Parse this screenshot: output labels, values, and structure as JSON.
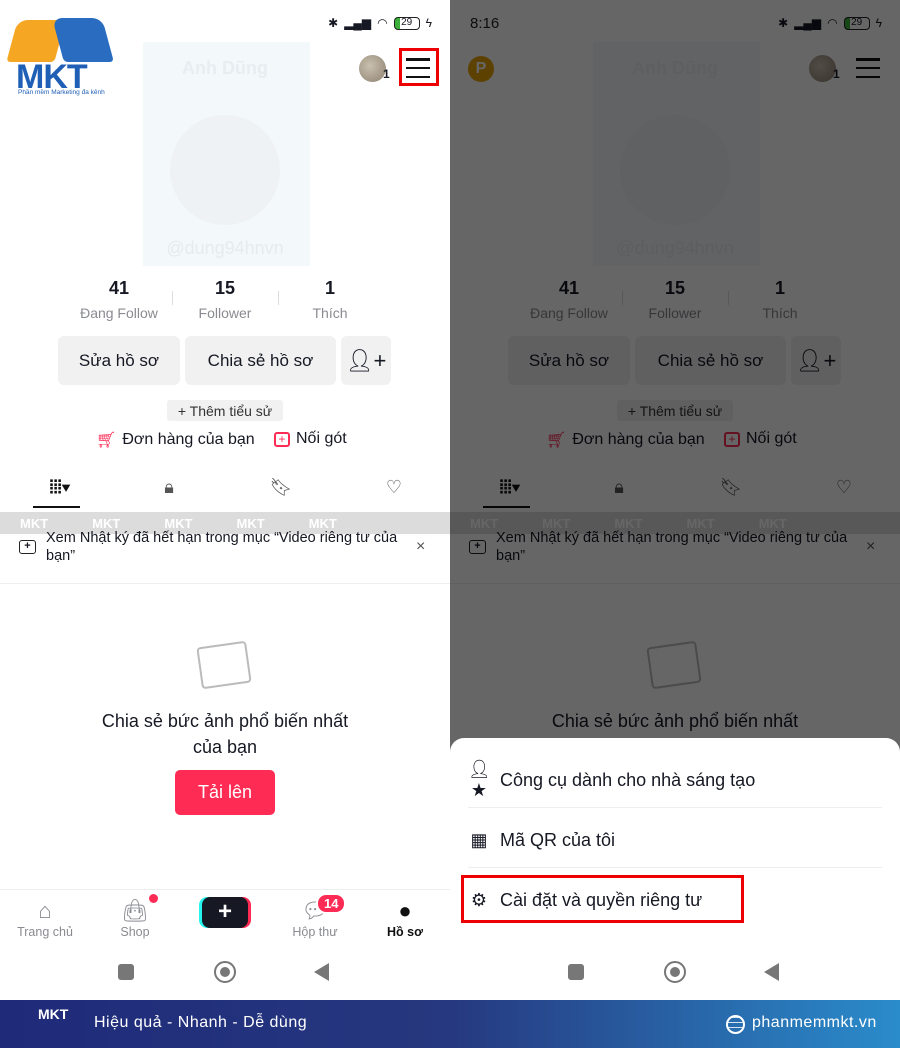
{
  "status": {
    "time": "8:16",
    "battery": "29"
  },
  "profile": {
    "name": "Anh Dũng",
    "handle": "@dung94hnvn",
    "notif_count": "1",
    "stats": [
      {
        "value": "41",
        "label": "Đang Follow"
      },
      {
        "value": "15",
        "label": "Follower"
      },
      {
        "value": "1",
        "label": "Thích"
      }
    ],
    "edit_label": "Sửa hồ sơ",
    "share_label": "Chia sẻ hồ sơ",
    "add_bio": "+ Thêm tiểu sử",
    "orders": "Đơn hàng của bạn",
    "follow_along": "Nối gót"
  },
  "notice": {
    "text": "Xem Nhật ký đã hết hạn trong mục “Video riêng tư của bạn”",
    "close": "×"
  },
  "empty": {
    "line1": "Chia sẻ bức ảnh phổ biến nhất",
    "line2": "của bạn",
    "upload": "Tải lên"
  },
  "nav": {
    "items": [
      {
        "label": "Trang chủ",
        "icon": "home-icon"
      },
      {
        "label": "Shop",
        "icon": "shopping-bag-icon"
      },
      {
        "label": "",
        "icon": "plus-icon"
      },
      {
        "label": "Hộp thư",
        "icon": "inbox-icon"
      },
      {
        "label": "Hồ sơ",
        "icon": "profile-icon"
      }
    ],
    "inbox_badge": "14",
    "active": "Hồ sơ"
  },
  "sheet": {
    "items": [
      {
        "label": "Công cụ dành cho nhà sáng tạo",
        "icon": "creator-tools-icon"
      },
      {
        "label": "Mã QR của tôi",
        "icon": "qr-code-icon"
      },
      {
        "label": "Cài đặt và quyền riêng tư",
        "icon": "settings-icon"
      }
    ]
  },
  "watermark": "MKT",
  "logo": {
    "text": "MKT",
    "tagline": "Phần mềm Marketing đa kênh"
  },
  "footer": {
    "slogan": "Hiệu quả - Nhanh - Dễ dùng",
    "website": "phanmemmkt.vn",
    "logo": "MKT"
  },
  "colors": {
    "accent": "#fe2c55",
    "highlight": "#e00000",
    "footer_start": "#1f2a79",
    "footer_end": "#2a8ccb"
  }
}
